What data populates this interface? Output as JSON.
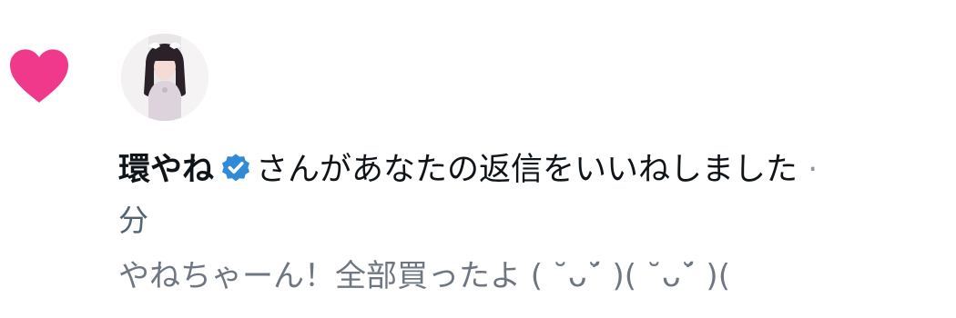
{
  "notification": {
    "type": "like",
    "user": {
      "display_name": "環やね",
      "verified": true,
      "avatar_icon": "avatar-photo"
    },
    "action_text": "さんがあなたの返信をいいねしました",
    "separator": "·",
    "time": "分",
    "reply_preview": "やねちゃーん！全部買ったよ ( ˘ᴗ˘́ )( ˘ᴗ˘́ )(",
    "icons": {
      "heart": "heart-icon",
      "verified": "verified-badge-icon"
    },
    "colors": {
      "heart": "#f91880",
      "verified": "#1d9bf0",
      "primary_text": "#0f1419",
      "secondary_text": "#536471"
    }
  }
}
